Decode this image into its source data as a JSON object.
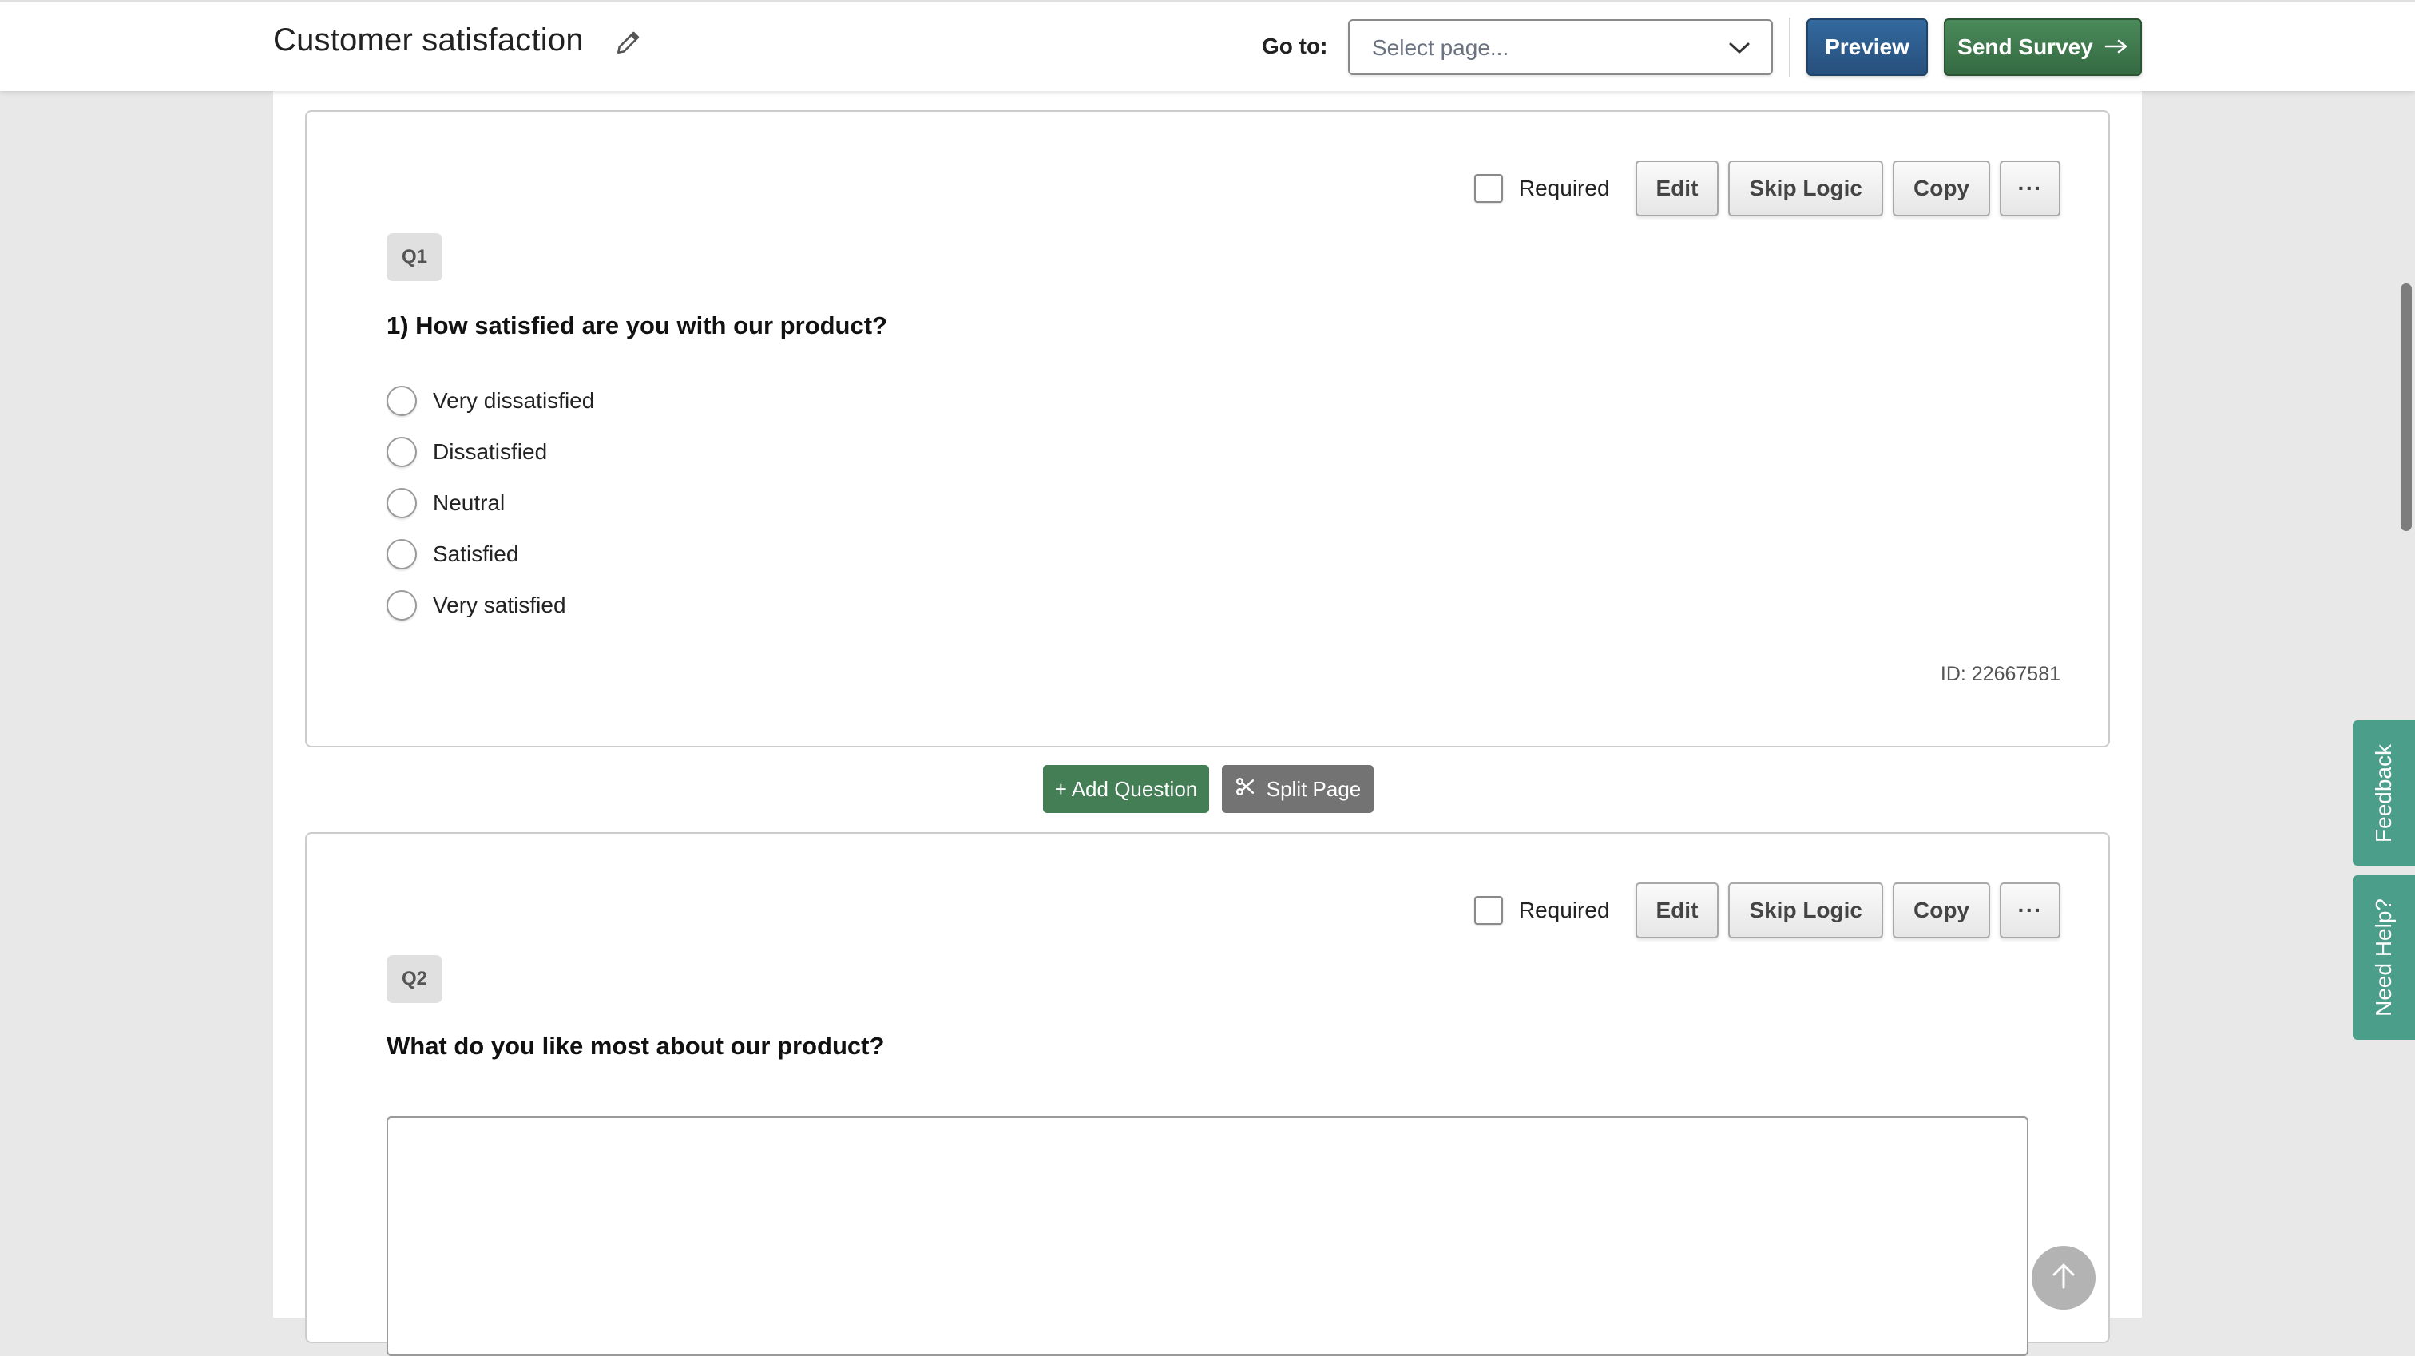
{
  "header": {
    "title": "Customer satisfaction",
    "edit_title_icon": "pencil-icon",
    "goto_label": "Go to:",
    "page_select_placeholder": "Select page...",
    "preview_label": "Preview",
    "send_label": "Send Survey",
    "send_icon": "arrow-right-icon"
  },
  "colors": {
    "preview_button": "#2d5f91",
    "send_button": "#3f7a4e",
    "add_question_button": "#437e55",
    "split_page_button": "#737373",
    "side_tabs": "#4a9e8a"
  },
  "questions": [
    {
      "badge": "Q1",
      "text": "1) How satisfied are you with our product?",
      "required_label": "Required",
      "required_checked": false,
      "buttons": {
        "edit": "Edit",
        "skip_logic": "Skip Logic",
        "copy": "Copy",
        "more": "···"
      },
      "options": [
        "Very dissatisfied",
        "Dissatisfied",
        "Neutral",
        "Satisfied",
        "Very satisfied"
      ],
      "id_label": "ID: 22667581"
    },
    {
      "badge": "Q2",
      "text": "What do you like most about our product?",
      "required_label": "Required",
      "required_checked": false,
      "buttons": {
        "edit": "Edit",
        "skip_logic": "Skip Logic",
        "copy": "Copy",
        "more": "···"
      },
      "answer_value": ""
    }
  ],
  "between_actions": {
    "add_question_label": "+ Add Question",
    "split_page_label": "Split Page",
    "split_icon": "scissors-icon"
  },
  "side_tabs": {
    "feedback_label": "Feedback",
    "help_label": "Need Help?"
  },
  "scroll_top_icon": "arrow-up-icon"
}
